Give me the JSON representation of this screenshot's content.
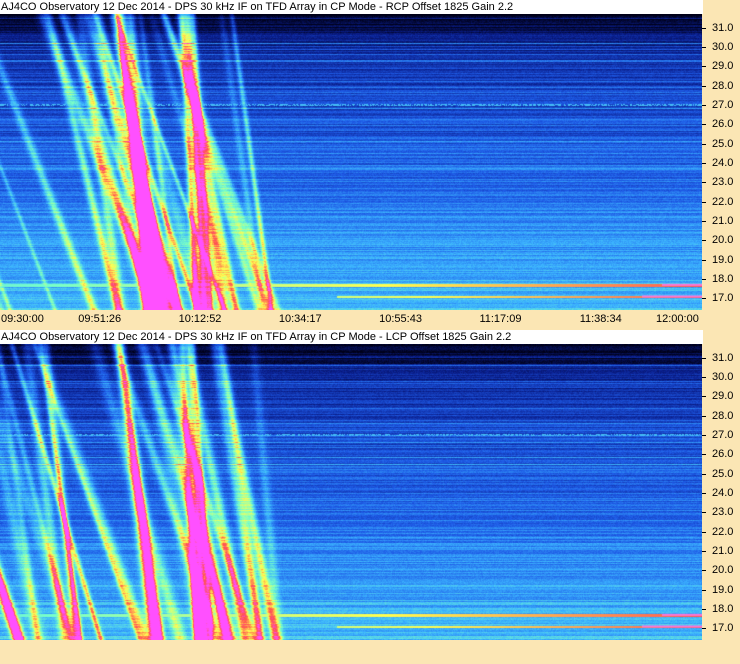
{
  "panels": [
    {
      "title": "AJ4CO Observatory 12 Dec 2014 - DPS 30 kHz IF on TFD Array in CP Mode - RCP     Offset 1825  Gain 2.2",
      "polarization": "RCP",
      "y_labels": [
        "31.0",
        "30.0",
        "29.0",
        "28.0",
        "27.0",
        "26.0",
        "25.0",
        "24.0",
        "23.0",
        "22.0",
        "21.0",
        "20.0",
        "19.0",
        "18.0",
        "17.0"
      ],
      "x_labels": [
        "09:30:00",
        "09:51:26",
        "10:12:52",
        "10:34:17",
        "10:55:43",
        "11:17:09",
        "11:38:34",
        "12:00:00"
      ]
    },
    {
      "title": "AJ4CO Observatory 12 Dec 2014 - DPS 30 kHz IF on TFD Array in CP Mode - LCP     Offset 1825  Gain 2.2",
      "polarization": "LCP",
      "y_labels": [
        "31.0",
        "30.0",
        "29.0",
        "28.0",
        "27.0",
        "26.0",
        "25.0",
        "24.0",
        "23.0",
        "22.0",
        "21.0",
        "20.0",
        "19.0",
        "18.0",
        "17.0"
      ],
      "x_labels": []
    }
  ],
  "chart_data": [
    {
      "type": "heatmap",
      "title": "AJ4CO Observatory 12 Dec 2014 - DPS 30 kHz IF on TFD Array in CP Mode - RCP     Offset 1825  Gain 2.2",
      "xlabel": "",
      "ylabel": "",
      "x_ticks": [
        "09:30:00",
        "09:51:26",
        "10:12:52",
        "10:34:17",
        "10:55:43",
        "11:17:09",
        "11:38:34",
        "12:00:00"
      ],
      "xlim": [
        "09:30:00",
        "12:00:00"
      ],
      "y_ticks": [
        31,
        30,
        29,
        28,
        27,
        26,
        25,
        24,
        23,
        22,
        21,
        20,
        19,
        18,
        17
      ],
      "ylim": [
        16.4,
        31.7
      ],
      "colormap": [
        "#000018",
        "#0a1e8c",
        "#1e5ae6",
        "#3cb4ff",
        "#78ffc8",
        "#ffff50",
        "#ff5050",
        "#ff50ff"
      ],
      "features": {
        "strong_bands_MHz": [
          17.7,
          17.1,
          27.0
        ],
        "burst_window": [
          "09:30:00",
          "10:30:00"
        ]
      }
    },
    {
      "type": "heatmap",
      "title": "AJ4CO Observatory 12 Dec 2014 - DPS 30 kHz IF on TFD Array in CP Mode - LCP     Offset 1825  Gain 2.2",
      "xlabel": "",
      "ylabel": "",
      "x_ticks": [],
      "xlim": [
        "09:30:00",
        "12:00:00"
      ],
      "y_ticks": [
        31,
        30,
        29,
        28,
        27,
        26,
        25,
        24,
        23,
        22,
        21,
        20,
        19,
        18,
        17
      ],
      "ylim": [
        16.4,
        31.7
      ],
      "colormap": [
        "#000018",
        "#0a1e8c",
        "#1e5ae6",
        "#3cb4ff",
        "#78ffc8",
        "#ffff50",
        "#ff5050",
        "#ff50ff"
      ],
      "features": {
        "strong_bands_MHz": [
          17.7,
          17.1,
          27.0
        ],
        "burst_window": [
          "09:30:00",
          "10:30:00"
        ]
      }
    }
  ]
}
